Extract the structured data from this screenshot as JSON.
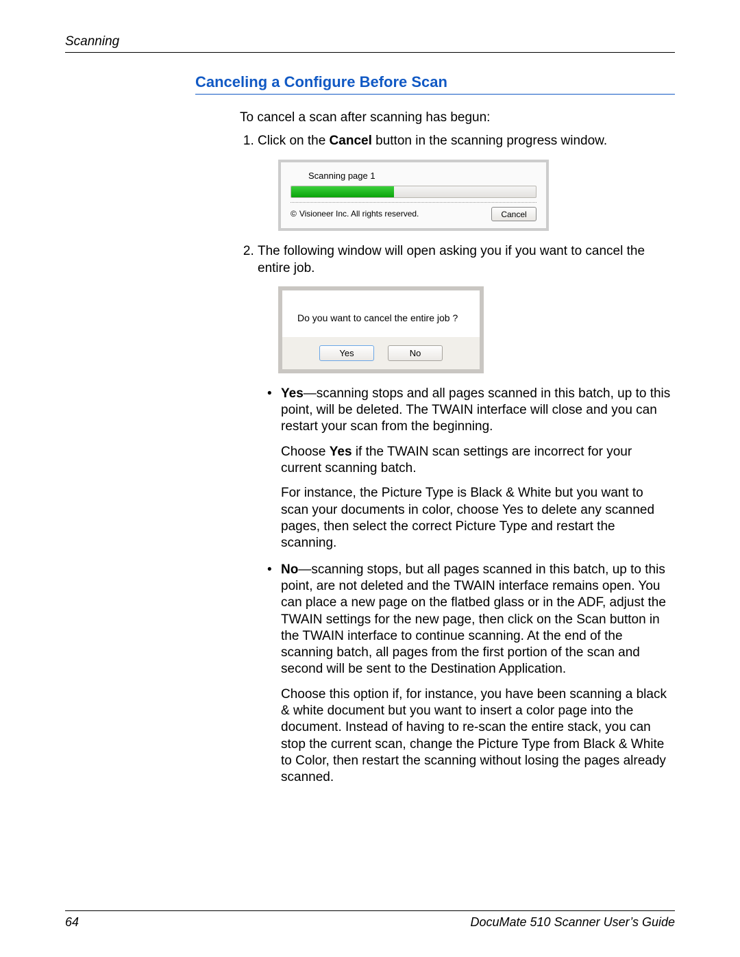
{
  "header": {
    "section": "Scanning"
  },
  "title": "Canceling a Configure Before Scan",
  "intro": "To cancel a scan after scanning has begun:",
  "steps": {
    "s1_pre": "Click on the ",
    "s1_b": "Cancel",
    "s1_post": " button in the scanning progress window.",
    "s2": "The following window will open asking you if you want to cancel the entire job."
  },
  "dlg1": {
    "label": "Scanning page 1",
    "copyright": "Visioneer Inc. All rights reserved.",
    "cancel": "Cancel"
  },
  "dlg2": {
    "prompt": "Do you want to cancel the entire job ?",
    "yes": "Yes",
    "no": "No"
  },
  "bullets": {
    "yes_b": "Yes",
    "yes_text": "—scanning stops and all pages scanned in this batch, up to this point, will be deleted. The TWAIN interface will close and you can restart your scan from the beginning.",
    "yes_p2a": "Choose ",
    "yes_p2b": "Yes",
    "yes_p2c": " if the TWAIN scan settings are incorrect for your current scanning batch.",
    "yes_p3": "For instance, the Picture Type is Black & White but you want to scan your documents in color, choose Yes to delete any scanned pages, then select the correct Picture Type and restart the scanning.",
    "no_b": "No",
    "no_text": "—scanning stops, but all pages scanned in this batch, up to this point, are not deleted and the TWAIN interface remains open. You can place a new page on the flatbed glass or in the ADF, adjust the TWAIN settings for the new page, then click on the Scan button in the TWAIN interface to continue scanning. At the end of the scanning batch, all pages from the first portion of the scan and second will be sent to the Destination Application.",
    "no_p2": "Choose this option if, for instance, you have been scanning a black & white document but you want to insert a color page into the document. Instead of having to re-scan the entire stack, you can stop the current scan, change the Picture Type from Black & White to Color, then restart the scanning without losing the pages already scanned."
  },
  "footer": {
    "page": "64",
    "book": "DocuMate 510 Scanner User’s Guide"
  }
}
